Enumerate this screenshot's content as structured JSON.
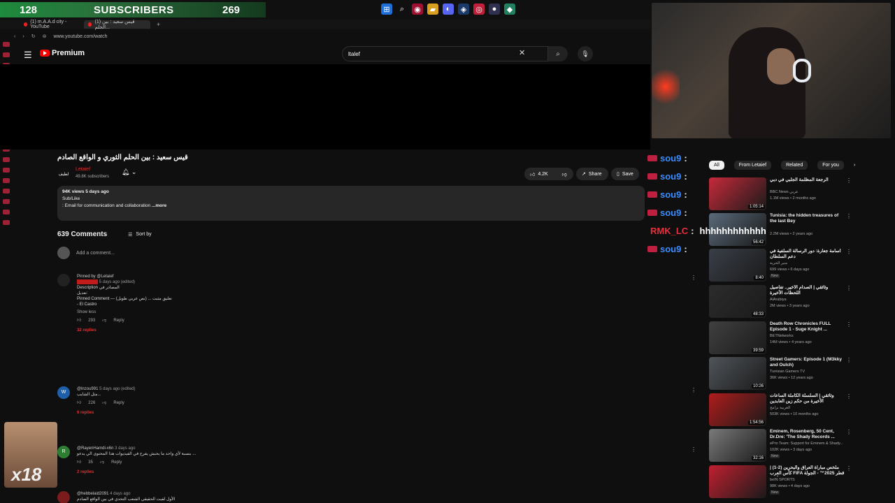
{
  "stream": {
    "sub_left": "128",
    "sub_title": "SUBSCRIBERS",
    "sub_right": "269"
  },
  "browser": {
    "tab1": "(1) m.A.A.d city - YouTube",
    "tab2": "(1) قيس سعيد : بين الحلم...",
    "url": "www.youtube.com/watch"
  },
  "youtube": {
    "brand": "Premium",
    "search_value": "ltalef"
  },
  "video": {
    "title": "قيس سعيد : بين الحلم الثوري و الواقع الصادم",
    "channel": "Letaief",
    "channel_avatar": "لطيف",
    "subscribers": "49.8K subscribers",
    "likes": "4.2K",
    "share": "Share",
    "save": "Save",
    "views": "94K views  5 days ago",
    "sub_like": "Sub/Like",
    "email": ": Email for communication and collaboration",
    "more": "...more"
  },
  "comments": {
    "count": "639 Comments",
    "sort": "Sort by",
    "add_placeholder": "Add a comment...",
    "items": [
      {
        "pinned": "Pinned by @Letaief",
        "time": "5 days ago (edited)",
        "heading": "Description المصادر في",
        "text1": "تعديل:",
        "text2": "Pinned Comment — تعليق مثبت ... (نص عربي طويل)",
        "text3": "- El Castro",
        "show_less": "Show less",
        "likes": "293",
        "reply": "Reply",
        "replies": "32 replies"
      },
      {
        "author": "@lnzou991",
        "time": "5 days ago (edited)",
        "avatar": "W",
        "text": "مثل الشايب...",
        "likes": "226",
        "reply": "Reply",
        "replies": "6 replies"
      },
      {
        "author": "@RayenHamdi-x6n",
        "time": "3 days ago",
        "avatar": "R",
        "text": "بنسبة لأي واحد ما يحبش يفرح في الفيديوات هذا المحتوى الي يدعو ...",
        "likes": "35",
        "reply": "Reply",
        "replies": "2 replies"
      },
      {
        "author": "@hebbelaid2091",
        "time": "4 days ago",
        "text": "الأول لقيت الحقيقي الشعب التحدي في بين الواقع الصادم"
      }
    ]
  },
  "chat": [
    {
      "name": "sou9",
      "msg": ""
    },
    {
      "name": "sou9",
      "msg": ""
    },
    {
      "name": "sou9",
      "msg": ""
    },
    {
      "name": "sou9",
      "msg": ""
    },
    {
      "name": "RMK_LC",
      "msg": "hhhhhhhhhhhh"
    },
    {
      "name": "sou9",
      "msg": ""
    }
  ],
  "related": {
    "chips": [
      "All",
      "From Letaief",
      "Related",
      "For you"
    ],
    "items": [
      {
        "title": "الرجعة المظلمة الجلبي في دبي",
        "channel": "BBC News عربي",
        "meta": "1.1M views • 2 months ago",
        "duration": "1:05:14",
        "badge": ""
      },
      {
        "title": "Tunisia: the hidden treasures of the last Bey",
        "channel": "",
        "meta": "2.2M views • 2 years ago",
        "duration": "56:42",
        "badge": ""
      },
      {
        "title": "أسامة جعارة: دور الرسالة السلفية في دعم السلطان",
        "channel": "منبر الحرية",
        "meta": "699 views • 6 days ago",
        "duration": "8:40",
        "badge": "New"
      },
      {
        "title": "وثائقي | الصدام الأخير.. تفاصيل اللحظات الأخيرة",
        "channel": "AlArabiya",
        "meta": "2M views • 3 years ago",
        "duration": "48:33",
        "badge": ""
      },
      {
        "title": "Death Row Chronicles FULL Episode 1 - Suge Knight ...",
        "channel": "BETNetworks",
        "meta": "14M views • 4 years ago",
        "duration": "39:59",
        "badge": ""
      },
      {
        "title": "Street Gamers: Episode 1 (M3kky and Oulch)",
        "channel": "Tunisian Gamers TV",
        "meta": "36K views • 12 years ago",
        "duration": "10:26",
        "badge": ""
      },
      {
        "title": "وثائقي | السلسلة الكاملة الساعات الأخيرة من حكم زين العابدين",
        "channel": "العربية برامج",
        "meta": "503K views • 10 months ago",
        "duration": "1:54:56",
        "badge": ""
      },
      {
        "title": "Eminem, Rosenberg, 50 Cent, Dr.Dre: 'The Shady Records ...",
        "channel": "ePro Team: Support for Eminem & Shady...",
        "meta": "102K views • 3 days ago",
        "duration": "32:16",
        "badge": "New"
      },
      {
        "title": "ملخص مباراة العراق والبحرين (2-1) | كأس العرب FIFA قطر 2025™ - الجولة الأولى",
        "channel": "beIN SPORTS",
        "meta": "98K views • 4 days ago",
        "duration": "",
        "badge": "New"
      }
    ]
  },
  "reaction": {
    "label": "x18"
  },
  "colors": {
    "accent": "#ff0000",
    "reply_red": "#e03030",
    "chat_blue": "#3a8cff"
  }
}
